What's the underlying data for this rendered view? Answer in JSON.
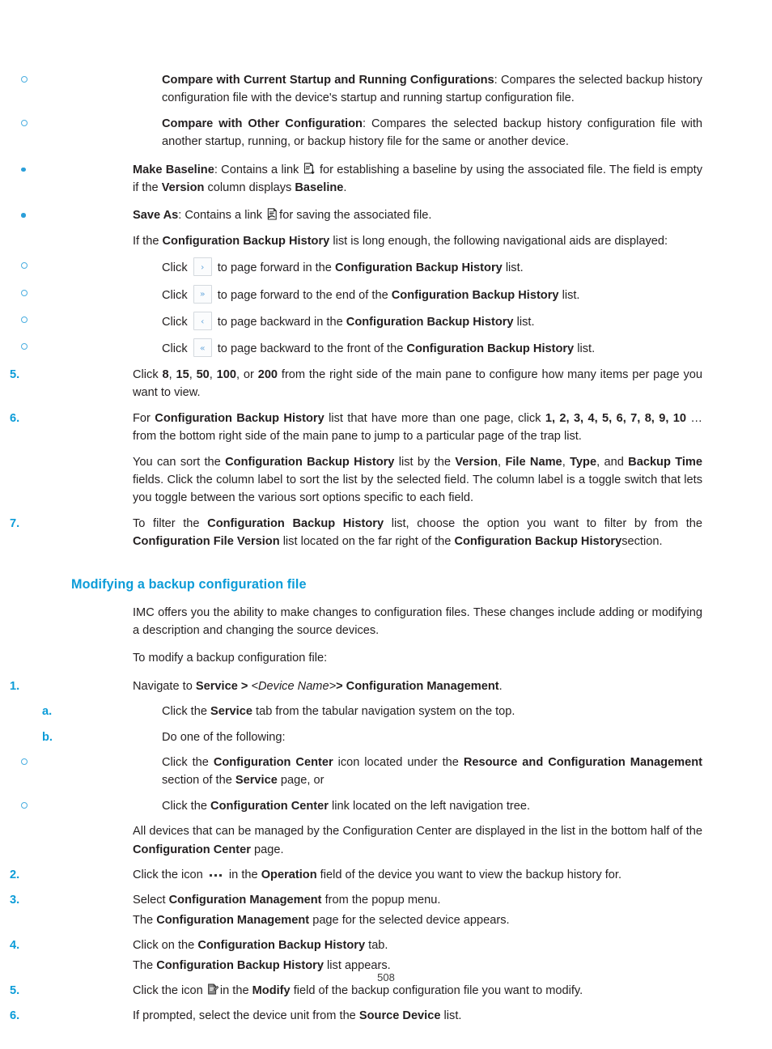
{
  "page": {
    "number": "508",
    "heading_color": "#0c9cd8",
    "marker_color": "#0c9cd8",
    "body_color": "#231f20"
  },
  "top_list": {
    "items": [
      {
        "marker": "o",
        "bold_lead": "Compare with Current Startup and Running Configurations",
        "rest": ": Compares the selected backup history configuration file with the device's startup and running startup configuration file."
      },
      {
        "marker": "o",
        "bold_lead": "Compare with Other Configuration",
        "rest": ": Compares the selected backup history configuration file with another startup, running, or backup history file for the same or another device."
      }
    ]
  },
  "bullets": {
    "make_baseline": {
      "lead": "Make Baseline",
      "text_a": ": Contains a link",
      "icon": "make-baseline-icon",
      "text_b": "for establishing a baseline by using the associated file. The field is empty if the",
      "bold_version": "Version",
      "text_c": "column displays",
      "bold_baseline": "Baseline",
      "text_d": "."
    },
    "save_as": {
      "lead": "Save As",
      "text_a": ": Contains a link",
      "icon": "save-as-icon",
      "text_b": "for saving the associated file."
    }
  },
  "nav_intro": {
    "text_a": "If the",
    "bold": "Configuration Backup History",
    "text_b": "list is long enough, the following navigational aids are displayed:"
  },
  "nav_aids": [
    {
      "click": "Click",
      "glyph": "›",
      "icon_name": "page-forward-icon",
      "text_a": "to page forward in the",
      "bold": "Configuration Backup History",
      "text_b": "list."
    },
    {
      "click": "Click",
      "glyph": "»",
      "icon_name": "page-last-icon",
      "text_a": "to page forward to the end of the",
      "bold": "Configuration Backup History",
      "text_b": "list."
    },
    {
      "click": "Click",
      "glyph": "‹",
      "icon_name": "page-backward-icon",
      "text_a": "to page backward in the",
      "bold": "Configuration Backup History",
      "text_b": "list."
    },
    {
      "click": "Click",
      "glyph": "«",
      "icon_name": "page-first-icon",
      "text_a": "to page backward to the front of the",
      "bold": "Configuration Backup History",
      "text_b": "list."
    }
  ],
  "steps_top": [
    {
      "num": "5.",
      "parts": {
        "a": "Click",
        "b1": "8",
        "b2": "15",
        "b3": "50",
        "b4": "100",
        "b5": "200",
        "c": "from the right side of the main pane to configure how many items per page you want to view.",
        "sep": ", ",
        "or": ", or "
      }
    },
    {
      "num": "6.",
      "parts": {
        "a": "For",
        "bold1": "Configuration Backup History",
        "b": "list that have more than one page, click",
        "pages": "1, 2, 3, 4, 5, 6, 7, 8, 9, 10",
        "c": "… from the bottom right side of the main pane to jump to a particular page of the trap list."
      }
    }
  ],
  "sort_para": {
    "a": "You can sort the",
    "bold1": "Configuration Backup History",
    "b": "list by the",
    "bold2": "Version",
    "s1": ",",
    "bold3": "File Name",
    "s2": ",",
    "bold4": "Type",
    "s3": ", and",
    "bold5": "Backup Time",
    "c": "fields. Click the column label to sort the list by the selected field. The column label is a toggle switch that lets you toggle between the various sort options specific to each field."
  },
  "step7": {
    "num": "7.",
    "a": "To filter the",
    "bold1": "Configuration Backup History",
    "b": "list, choose the option you want to filter by from the",
    "bold2": "Configuration File Version",
    "c": "list located on the far right of the",
    "bold3": "Configuration Backup History",
    "d": "section."
  },
  "section": {
    "heading": "Modifying a backup configuration file",
    "intro": "IMC offers you the ability to make changes to configuration files. These changes include adding or modifying a description and changing the source devices.",
    "lead_in": "To modify a backup configuration file:"
  },
  "steps": [
    {
      "num": "1.",
      "a": "Navigate to",
      "bold1": "Service >",
      "italic": "<Device Name>",
      "bold2": "> Configuration Management",
      "c": "."
    },
    {
      "letter": "a.",
      "a": "Click the",
      "bold1": "Service",
      "b": "tab from the tabular navigation system on the top."
    },
    {
      "letter": "b.",
      "a": "Do one of the following:"
    },
    {
      "marker": "o",
      "a": "Click the",
      "bold1": "Configuration Center",
      "b": "icon located under the",
      "bold2": "Resource and Configuration Management",
      "c": "section of the",
      "bold3": "Service",
      "d": "page, or"
    },
    {
      "marker": "o",
      "a": "Click the",
      "bold1": "Configuration Center",
      "b": "link located on the left navigation tree."
    }
  ],
  "devices_para": {
    "a": "All devices that can be managed by the Configuration Center are displayed in the list in the bottom half of the",
    "bold1": "Configuration Center",
    "b": "page."
  },
  "steps_tail": [
    {
      "num": "2.",
      "a": "Click the icon",
      "icon": "operation-dots-icon",
      "b": "in the",
      "bold1": "Operation",
      "c": "field of the device you want to view the backup history for."
    },
    {
      "num": "3.",
      "a": "Select",
      "bold1": "Configuration Management",
      "b": "from the popup menu.",
      "sub": {
        "a": "The",
        "bold1": "Configuration Management",
        "b": "page for the selected device appears."
      }
    },
    {
      "num": "4.",
      "a": "Click on the",
      "bold1": "Configuration Backup History",
      "b": "tab.",
      "sub": {
        "a": "The",
        "bold1": "Configuration Backup History",
        "b": "list appears."
      }
    },
    {
      "num": "5.",
      "a": "Click the icon",
      "icon": "modify-icon",
      "b": "in the",
      "bold1": "Modify",
      "c": "field of the backup configuration file you want to modify."
    },
    {
      "num": "6.",
      "a": "If prompted, select the device unit from the",
      "bold1": "Source Device",
      "b": "list."
    }
  ]
}
